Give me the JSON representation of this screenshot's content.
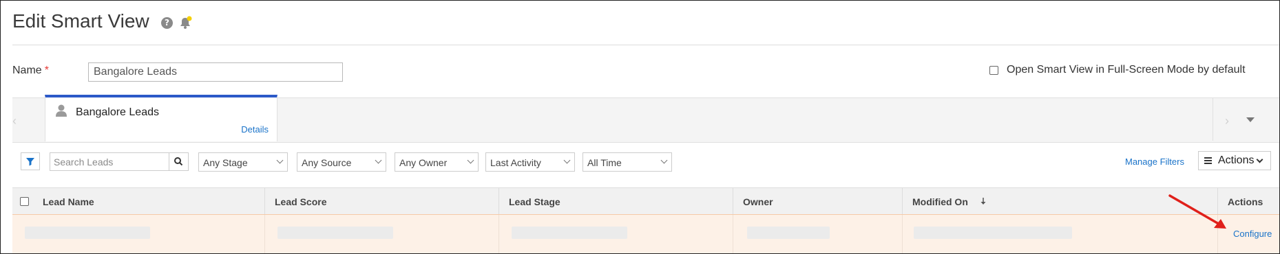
{
  "page": {
    "title": "Edit Smart View",
    "name_label": "Name",
    "required_mark": "*",
    "name_value": "Bangalore Leads",
    "fullscreen_label": "Open Smart View in Full-Screen Mode by default"
  },
  "icons": {
    "help": "question-circle-icon",
    "bell": "bell-icon",
    "user": "user-icon",
    "filter": "filter-icon",
    "search": "search-icon",
    "menu": "hamburger-icon",
    "annotation": "red-arrow-icon"
  },
  "tab": {
    "title": "Bangalore Leads",
    "details_link": "Details"
  },
  "filters": {
    "search_placeholder": "Search Leads",
    "stage": "Any Stage",
    "source": "Any Source",
    "owner": "Any Owner",
    "activity": "Last Activity",
    "time": "All Time",
    "manage_filters": "Manage Filters",
    "actions_label": "Actions"
  },
  "grid": {
    "columns": [
      "Lead Name",
      "Lead Score",
      "Lead Stage",
      "Owner",
      "Modified On",
      "Actions"
    ],
    "row_action": "Configure"
  },
  "colors": {
    "accent": "#2c59c8",
    "link": "#1a73c9",
    "row_highlight": "#fdf1e7",
    "annotation": "#e0201a",
    "required": "#e53935"
  }
}
